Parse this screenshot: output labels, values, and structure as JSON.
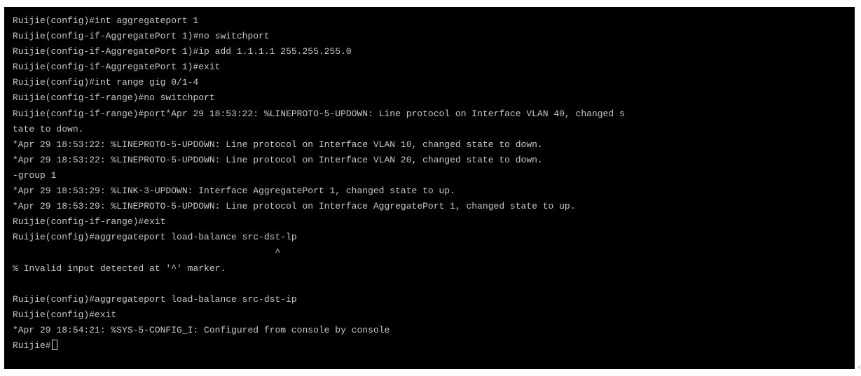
{
  "terminal": {
    "lines": [
      "Ruijie(config)#int aggregateport 1",
      "Ruijie(config-if-AggregatePort 1)#no switchport",
      "Ruijie(config-if-AggregatePort 1)#ip add 1.1.1.1 255.255.255.0",
      "Ruijie(config-if-AggregatePort 1)#exit",
      "Ruijie(config)#int range gig 0/1-4",
      "Ruijie(config-if-range)#no switchport",
      "Ruijie(config-if-range)#port*Apr 29 18:53:22: %LINEPROTO-5-UPDOWN: Line protocol on Interface VLAN 40, changed s",
      "tate to down.",
      "*Apr 29 18:53:22: %LINEPROTO-5-UPDOWN: Line protocol on Interface VLAN 10, changed state to down.",
      "*Apr 29 18:53:22: %LINEPROTO-5-UPDOWN: Line protocol on Interface VLAN 20, changed state to down.",
      "-group 1",
      "*Apr 29 18:53:29: %LINK-3-UPDOWN: Interface AggregatePort 1, changed state to up.",
      "*Apr 29 18:53:29: %LINEPROTO-5-UPDOWN: Line protocol on Interface AggregatePort 1, changed state to up.",
      "Ruijie(config-if-range)#exit",
      "Ruijie(config)#aggregateport load-balance src-dst-lp",
      "                                                ^",
      "% Invalid input detected at '^' marker.",
      "",
      "Ruijie(config)#aggregateport load-balance src-dst-ip",
      "Ruijie(config)#exit",
      "*Apr 29 18:54:21: %SYS-5-CONFIG_I: Configured from console by console"
    ],
    "prompt": "Ruijie#",
    "edge_mark": "‹"
  },
  "colors": {
    "background": "#000000",
    "text": "#c7c7c7",
    "page": "#ffffff"
  }
}
